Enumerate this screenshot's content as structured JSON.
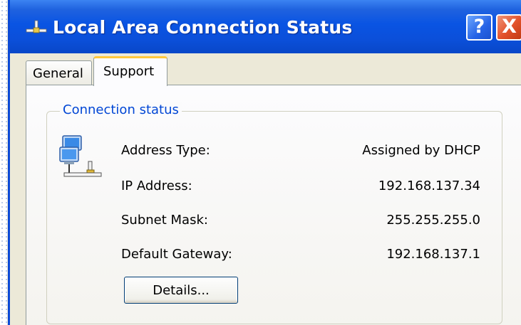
{
  "window": {
    "title": "Local Area Connection Status",
    "help_glyph": "?",
    "close_glyph": "X",
    "title_icon": "network-connection-icon"
  },
  "tabs": [
    {
      "label": "General",
      "selected": false
    },
    {
      "label": "Support",
      "selected": true
    }
  ],
  "connection_status": {
    "group_label": "Connection status",
    "icon": "network-computers-icon",
    "rows": [
      {
        "label": "Address Type:",
        "value": "Assigned by DHCP"
      },
      {
        "label": "IP Address:",
        "value": "192.168.137.34"
      },
      {
        "label": "Subnet Mask:",
        "value": "255.255.255.0"
      },
      {
        "label": "Default Gateway:",
        "value": "192.168.137.1"
      }
    ],
    "details_label": "Details..."
  },
  "colors": {
    "titlebar": "#0a54e3",
    "group_label": "#0046d5",
    "selected_tab_accent": "#ffc83c",
    "close_button": "#e2512a"
  }
}
